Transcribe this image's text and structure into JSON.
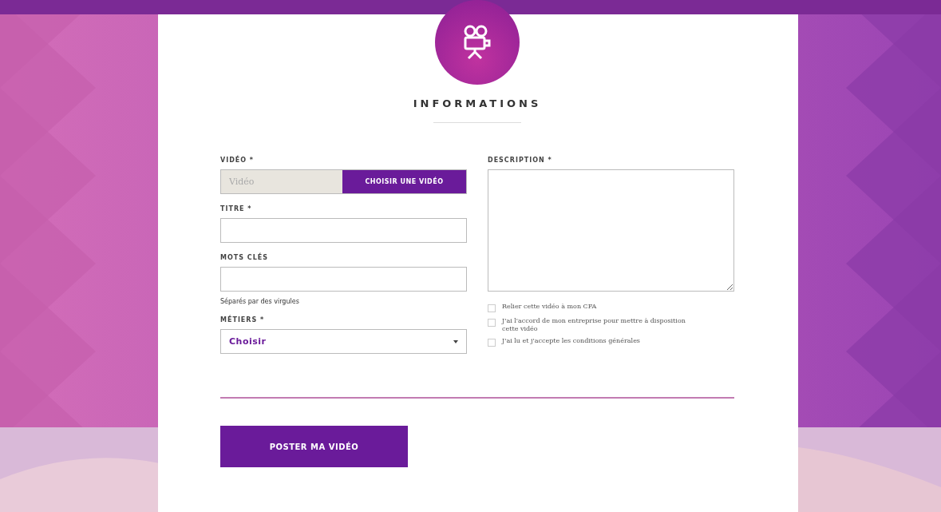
{
  "heading": "INFORMATIONS",
  "left_fields": [
    {
      "kind": "file",
      "label": "VIDÉO *",
      "placeholder": "Vidéo",
      "button": "CHOISIR UNE VIDÉO"
    },
    {
      "kind": "text",
      "label": "TITRE *"
    },
    {
      "kind": "text",
      "label": "MOTS CLÉS",
      "hint": "Séparés par des virgules"
    },
    {
      "kind": "select",
      "label": "MÉTIERS *",
      "value": "Choisir"
    }
  ],
  "description": {
    "label": "DESCRIPTION *"
  },
  "checkboxes": [
    {
      "label": "Relier cette vidéo à mon CFA",
      "checked": false
    },
    {
      "label": "J'ai l'accord de mon entreprise pour mettre à disposition cette vidéo",
      "checked": false
    },
    {
      "label": "J'ai lu et j'accepte les conditions générales",
      "checked": false
    }
  ],
  "submit": "POSTER MA VIDÉO"
}
